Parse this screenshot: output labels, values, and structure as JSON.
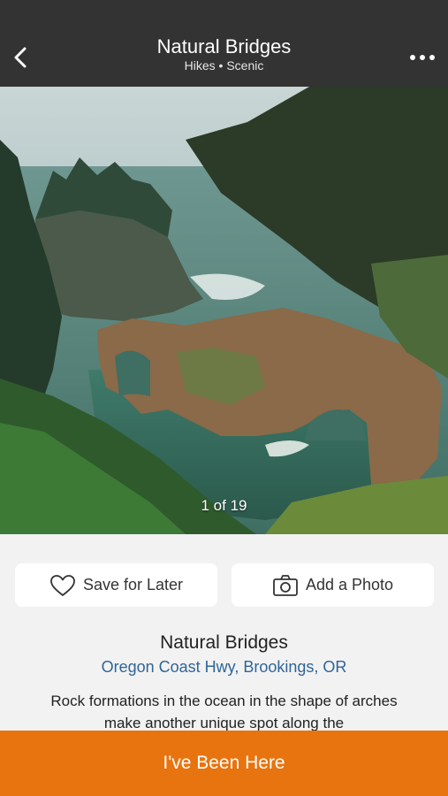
{
  "header": {
    "title": "Natural Bridges",
    "subtitle": "Hikes • Scenic",
    "back_icon": "chevron-left-icon",
    "more_icon": "more-horizontal-icon"
  },
  "gallery": {
    "counter": "1 of 19"
  },
  "actions": {
    "save_label": "Save for Later",
    "save_icon": "heart-outline-icon",
    "photo_label": "Add a Photo",
    "photo_icon": "camera-icon"
  },
  "place": {
    "name": "Natural Bridges",
    "address": "Oregon Coast Hwy, Brookings, OR",
    "description": "Rock formations in the ocean in the shape of arches make another unique spot along the"
  },
  "cta": {
    "label": "I've Been Here"
  },
  "colors": {
    "header_bg": "#333333",
    "cta_bg": "#e8740f",
    "link": "#2e6599"
  }
}
